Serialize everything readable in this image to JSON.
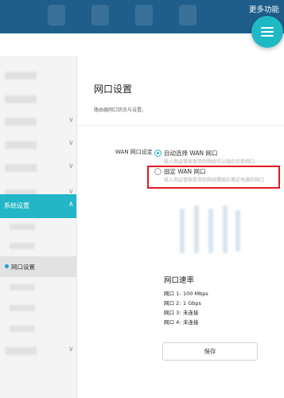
{
  "header": {
    "more_label": "更多功能"
  },
  "sidebar": {
    "active_section": "系统设置",
    "selected_item": "网口设置"
  },
  "main": {
    "title": "网口设置",
    "description": "路由器网口状态与设置。",
    "wan_setting_label": "WAN 网口设定",
    "options": [
      {
        "title": "自动选择 WAN 网口",
        "desc": "接入到运营商宽带的网线可以插在任意网口",
        "selected": true
      },
      {
        "title": "固定 WAN 网口",
        "desc": "接入到运营商宽带的网线需插在靠近电源的网口",
        "selected": false
      }
    ],
    "speed_title": "网口速率",
    "ports": [
      {
        "name": "网口 1:",
        "status": "100 Mbps"
      },
      {
        "name": "网口 2:",
        "status": "1 Gbps"
      },
      {
        "name": "网口 3:",
        "status": "未连接"
      },
      {
        "name": "网口 4:",
        "status": "未连接"
      }
    ],
    "save_label": "保存"
  },
  "colors": {
    "header": "#1f5e8a",
    "accent": "#23b6c6",
    "highlight_box": "#e01b22"
  }
}
